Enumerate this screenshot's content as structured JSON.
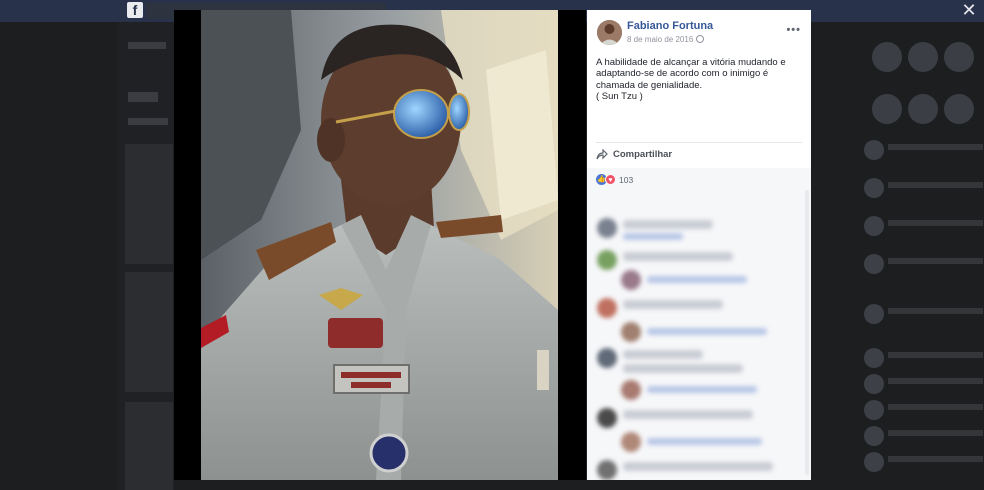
{
  "post": {
    "author": "Fabiano Fortuna",
    "date": "8 de maio de 2016",
    "text": "A habilidade de alcançar a vitória mudando e adaptando-se de acordo com o inimigo é chamada de genialidade.\n( Sun Tzu )",
    "share_label": "Compartilhar",
    "reaction_count": "103"
  },
  "icons": {
    "close": "close-icon",
    "more": "more-options-icon",
    "globe": "globe-icon",
    "share": "share-icon",
    "like": "like-reaction-icon",
    "love": "love-reaction-icon",
    "facebook": "facebook-logo"
  },
  "colors": {
    "link_blue": "#365899",
    "overlay": "#1d1e20",
    "like": "#4b76d4",
    "love": "#f25268"
  }
}
